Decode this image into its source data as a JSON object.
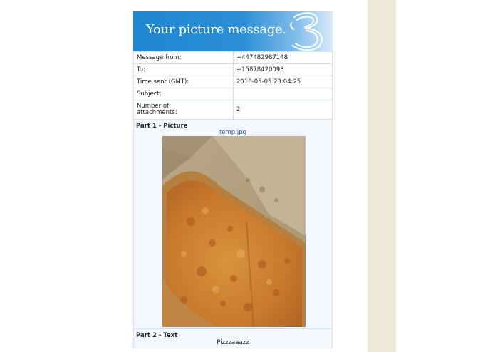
{
  "banner": {
    "title": "Your picture message.",
    "logo_icon": "three-logo-icon",
    "colors": {
      "start": "#1f86d1",
      "end": "#d9ebf9"
    }
  },
  "details": {
    "rows": [
      {
        "label": "Message from:",
        "value": "+447482987148"
      },
      {
        "label": "To:",
        "value": "+15878420093"
      },
      {
        "label": "Time sent (GMT):",
        "value": "2018-05-05 23:04:25"
      },
      {
        "label": "Subject:",
        "value": ""
      },
      {
        "label_line1": "Number of",
        "label_line2": "attachments:",
        "value": "2"
      }
    ]
  },
  "part1": {
    "title": "Part 1 - Picture",
    "file_name": "temp.jpg",
    "image": "pizza-slices-in-box"
  },
  "part2": {
    "title": "Part 2 - Text",
    "text": "Pizzzaaazz"
  }
}
